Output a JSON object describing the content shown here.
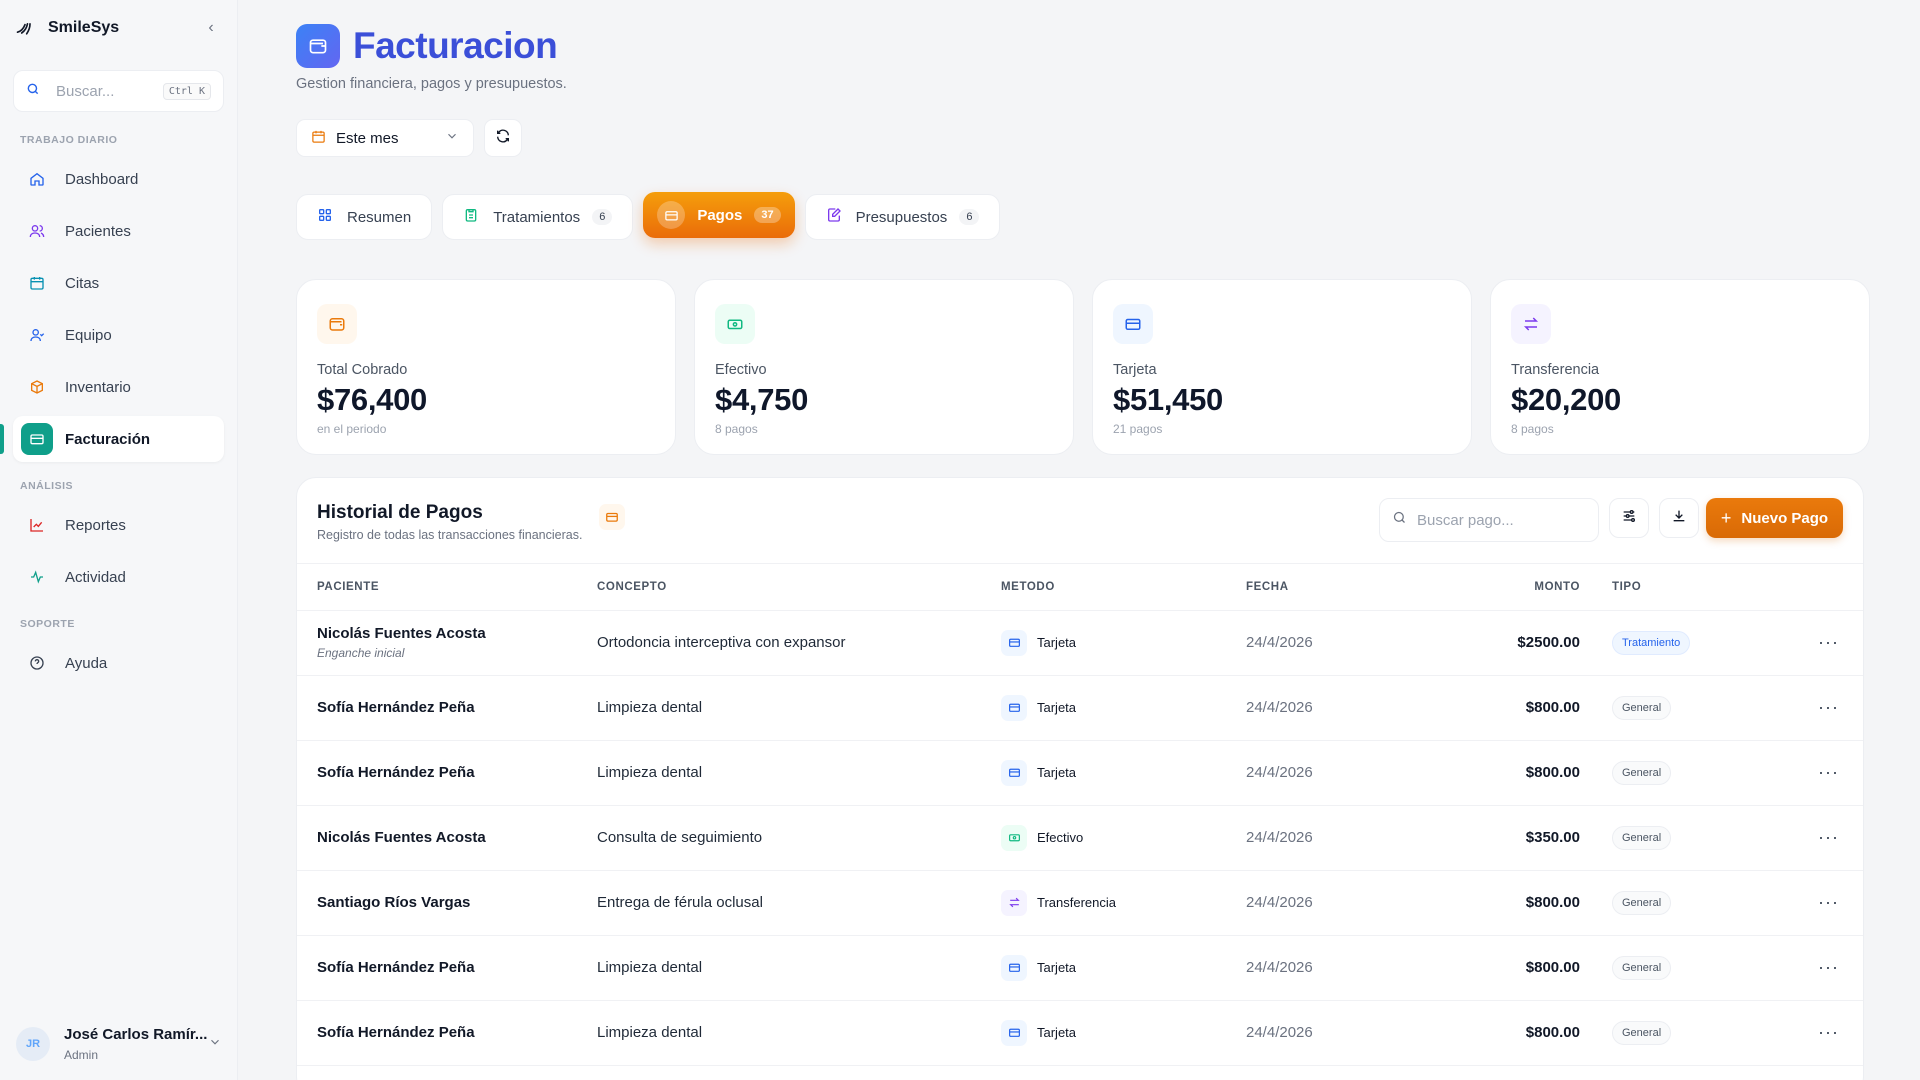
{
  "brand": {
    "name": "SmileSys"
  },
  "search": {
    "placeholder": "Buscar...",
    "shortcut": "Ctrl K"
  },
  "sections": {
    "daily": "TRABAJO DIARIO",
    "analysis": "ANÁLISIS",
    "support": "SOPORTE"
  },
  "nav": {
    "dashboard": "Dashboard",
    "pacientes": "Pacientes",
    "citas": "Citas",
    "equipo": "Equipo",
    "inventario": "Inventario",
    "facturacion": "Facturación",
    "reportes": "Reportes",
    "actividad": "Actividad",
    "ayuda": "Ayuda"
  },
  "user": {
    "initials": "JR",
    "name": "José Carlos Ramír...",
    "role": "Admin"
  },
  "page": {
    "title": "Facturacion",
    "subtitle": "Gestion financiera, pagos y presupuestos."
  },
  "period": {
    "label": "Este mes"
  },
  "tabs": {
    "resumen": {
      "label": "Resumen"
    },
    "tratamientos": {
      "label": "Tratamientos",
      "count": "6"
    },
    "pagos": {
      "label": "Pagos",
      "count": "37"
    },
    "presupuestos": {
      "label": "Presupuestos",
      "count": "6"
    }
  },
  "stats": [
    {
      "label": "Total Cobrado",
      "value": "$76,400",
      "sub": "en el periodo"
    },
    {
      "label": "Efectivo",
      "value": "$4,750",
      "sub": "8 pagos"
    },
    {
      "label": "Tarjeta",
      "value": "$51,450",
      "sub": "21 pagos"
    },
    {
      "label": "Transferencia",
      "value": "$20,200",
      "sub": "8 pagos"
    }
  ],
  "history": {
    "title": "Historial de Pagos",
    "subtitle": "Registro de todas las transacciones financieras.",
    "search_placeholder": "Buscar pago...",
    "new_button": "Nuevo Pago",
    "columns": {
      "paciente": "PACIENTE",
      "concepto": "CONCEPTO",
      "metodo": "METODO",
      "fecha": "FECHA",
      "monto": "MONTO",
      "tipo": "TIPO"
    },
    "rows": [
      {
        "paciente": "Nicolás Fuentes Acosta",
        "nota": "Enganche inicial",
        "concepto": "Ortodoncia interceptiva con expansor",
        "metodo": "Tarjeta",
        "fecha": "24/4/2026",
        "monto": "$2500.00",
        "tipo": "Tratamiento"
      },
      {
        "paciente": "Sofía Hernández Peña",
        "nota": "",
        "concepto": "Limpieza dental",
        "metodo": "Tarjeta",
        "fecha": "24/4/2026",
        "monto": "$800.00",
        "tipo": "General"
      },
      {
        "paciente": "Sofía Hernández Peña",
        "nota": "",
        "concepto": "Limpieza dental",
        "metodo": "Tarjeta",
        "fecha": "24/4/2026",
        "monto": "$800.00",
        "tipo": "General"
      },
      {
        "paciente": "Nicolás Fuentes Acosta",
        "nota": "",
        "concepto": "Consulta de seguimiento",
        "metodo": "Efectivo",
        "fecha": "24/4/2026",
        "monto": "$350.00",
        "tipo": "General"
      },
      {
        "paciente": "Santiago Ríos Vargas",
        "nota": "",
        "concepto": "Entrega de férula oclusal",
        "metodo": "Transferencia",
        "fecha": "24/4/2026",
        "monto": "$800.00",
        "tipo": "General"
      },
      {
        "paciente": "Sofía Hernández Peña",
        "nota": "",
        "concepto": "Limpieza dental",
        "metodo": "Tarjeta",
        "fecha": "24/4/2026",
        "monto": "$800.00",
        "tipo": "General"
      },
      {
        "paciente": "Sofía Hernández Peña",
        "nota": "",
        "concepto": "Limpieza dental",
        "metodo": "Tarjeta",
        "fecha": "24/4/2026",
        "monto": "$800.00",
        "tipo": "General"
      }
    ]
  },
  "colors": {
    "accent": "#3b4fd8",
    "orange": "#ea7a0c",
    "teal": "#0f9f8a",
    "blue": "#2563eb",
    "purple": "#7c3aed",
    "green": "#10b981"
  }
}
